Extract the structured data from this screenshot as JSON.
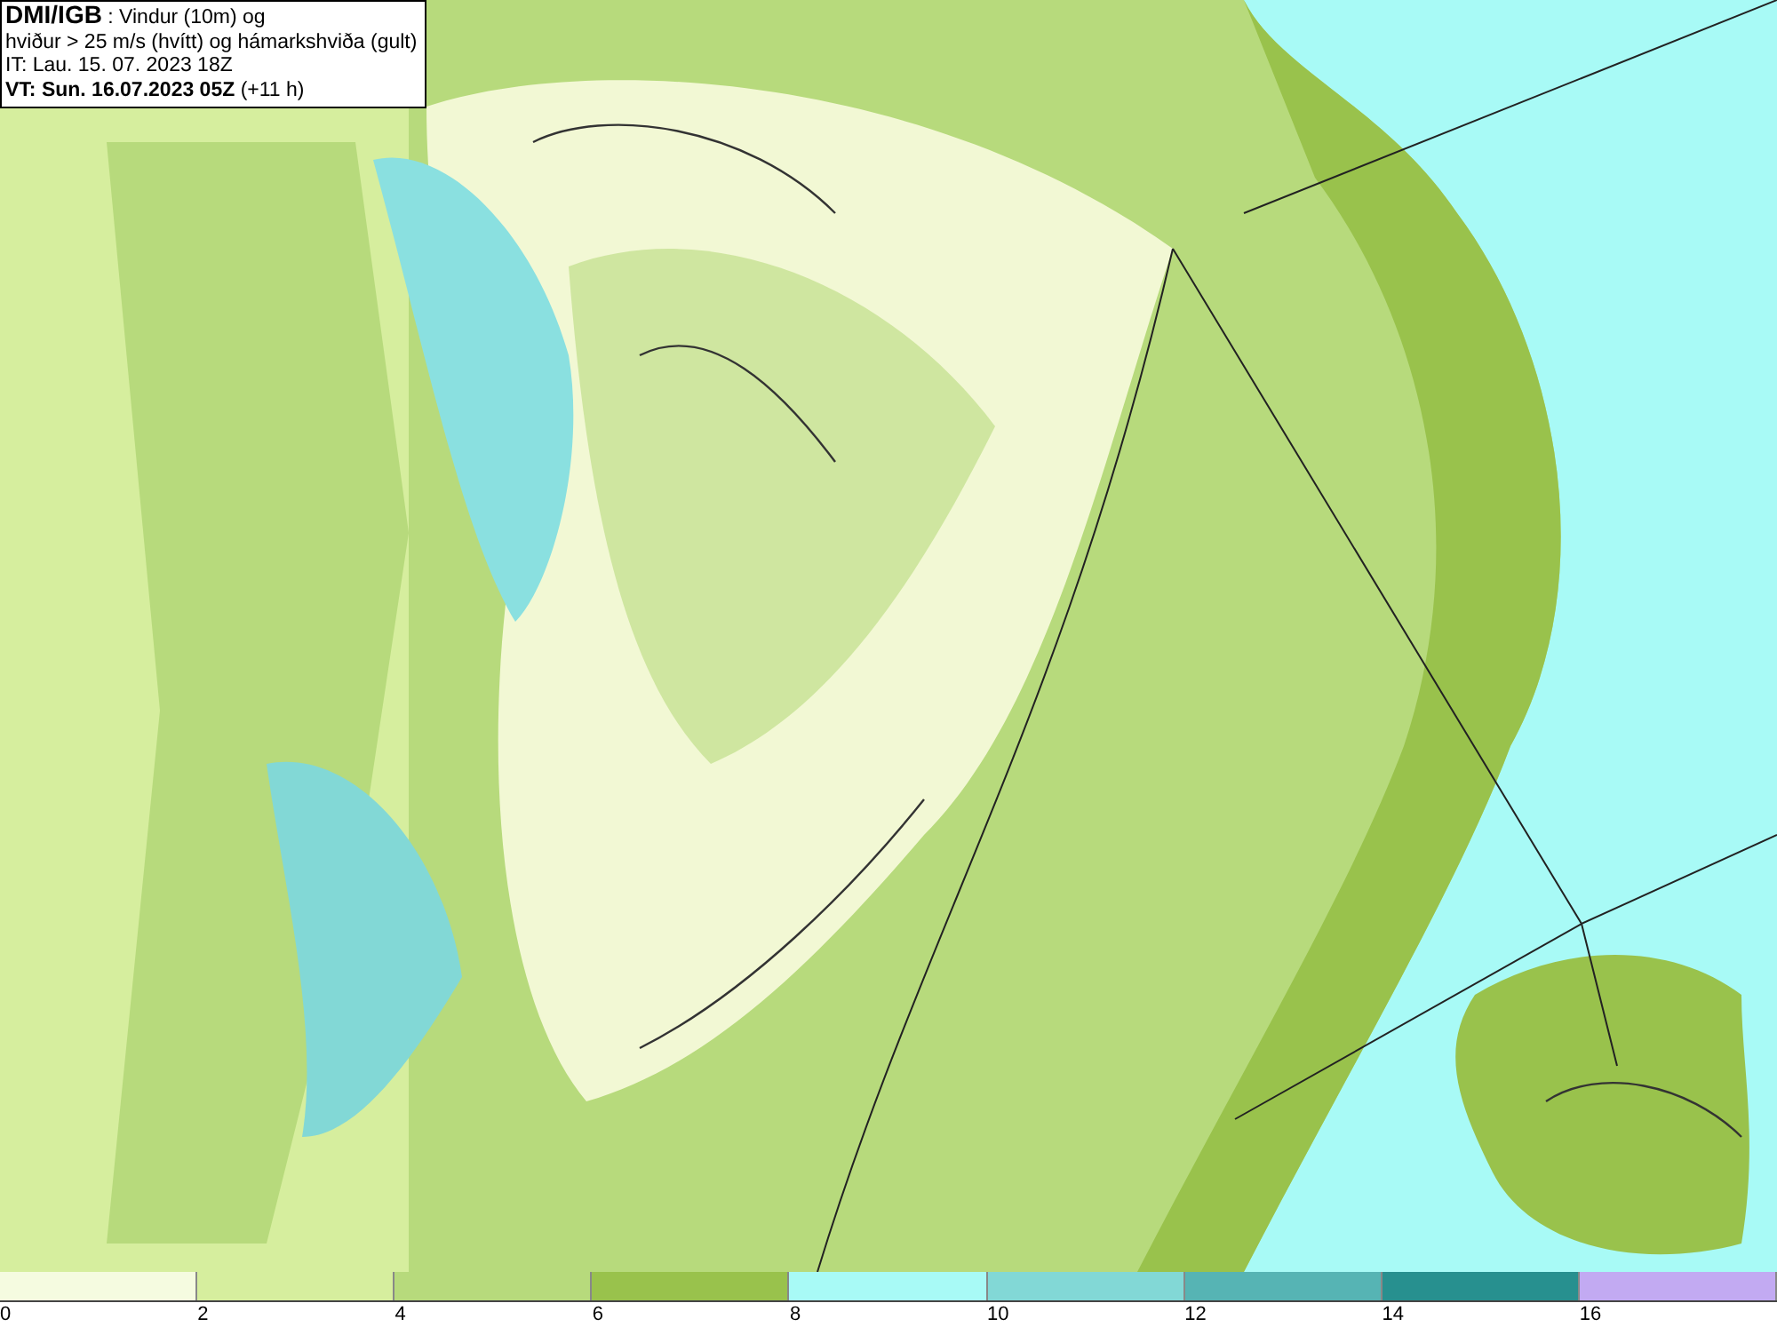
{
  "title_box": {
    "lines": [
      "**DMI/IGB** : Vindur (10m) og",
      "hviður > 25 m/s (hvítt) og hámarkshviða (gult)",
      "IT: Lau. 15. 07. 2023 18Z",
      "**VT: Sun. 16.07.2023 05Z** (+11 h)"
    ]
  },
  "legend": {
    "bins": [
      {
        "color": "#f5fbe0"
      },
      {
        "color": "#d6ee9e"
      },
      {
        "color": "#b7da7c"
      },
      {
        "color": "#99c24c"
      },
      {
        "color": "#a8faf6"
      },
      {
        "color": "#82d8d6"
      },
      {
        "color": "#56b4b4"
      },
      {
        "color": "#27908f"
      },
      {
        "color": "#c2aaf2"
      }
    ],
    "ticks": [
      "0",
      "2",
      "4",
      "6",
      "8",
      "10",
      "12",
      "14",
      "16"
    ]
  }
}
